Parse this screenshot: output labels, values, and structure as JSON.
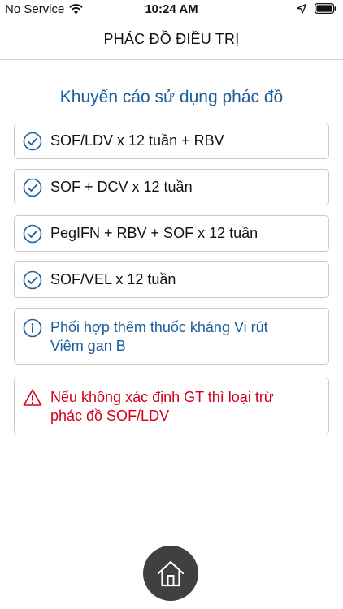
{
  "status_bar": {
    "carrier": "No Service",
    "time": "10:24 AM"
  },
  "header": {
    "title": "PHÁC ĐỒ ĐIỀU TRỊ"
  },
  "main": {
    "heading": "Khuyến cáo sử dụng phác đồ",
    "recommendations": [
      {
        "label": "SOF/LDV x 12 tuần + RBV",
        "icon": "check-circle-icon"
      },
      {
        "label": "SOF + DCV x 12 tuần",
        "icon": "check-circle-icon"
      },
      {
        "label": "PegIFN + RBV + SOF x 12 tuần",
        "icon": "check-circle-icon"
      },
      {
        "label": "SOF/VEL x 12 tuần",
        "icon": "check-circle-icon"
      }
    ],
    "info": {
      "line1": "Phối hợp thêm thuốc kháng Vi rút",
      "line2": "Viêm gan B",
      "icon": "info-circle-icon"
    },
    "warning": {
      "line1": "Nếu không xác định GT thì loại trừ",
      "line2": "phác đồ SOF/LDV",
      "icon": "warning-triangle-icon"
    }
  },
  "footer": {
    "home_icon": "home-icon"
  },
  "colors": {
    "accent_blue": "#1c5d9b",
    "warning_red": "#d0021b",
    "home_button_bg": "#404040"
  }
}
